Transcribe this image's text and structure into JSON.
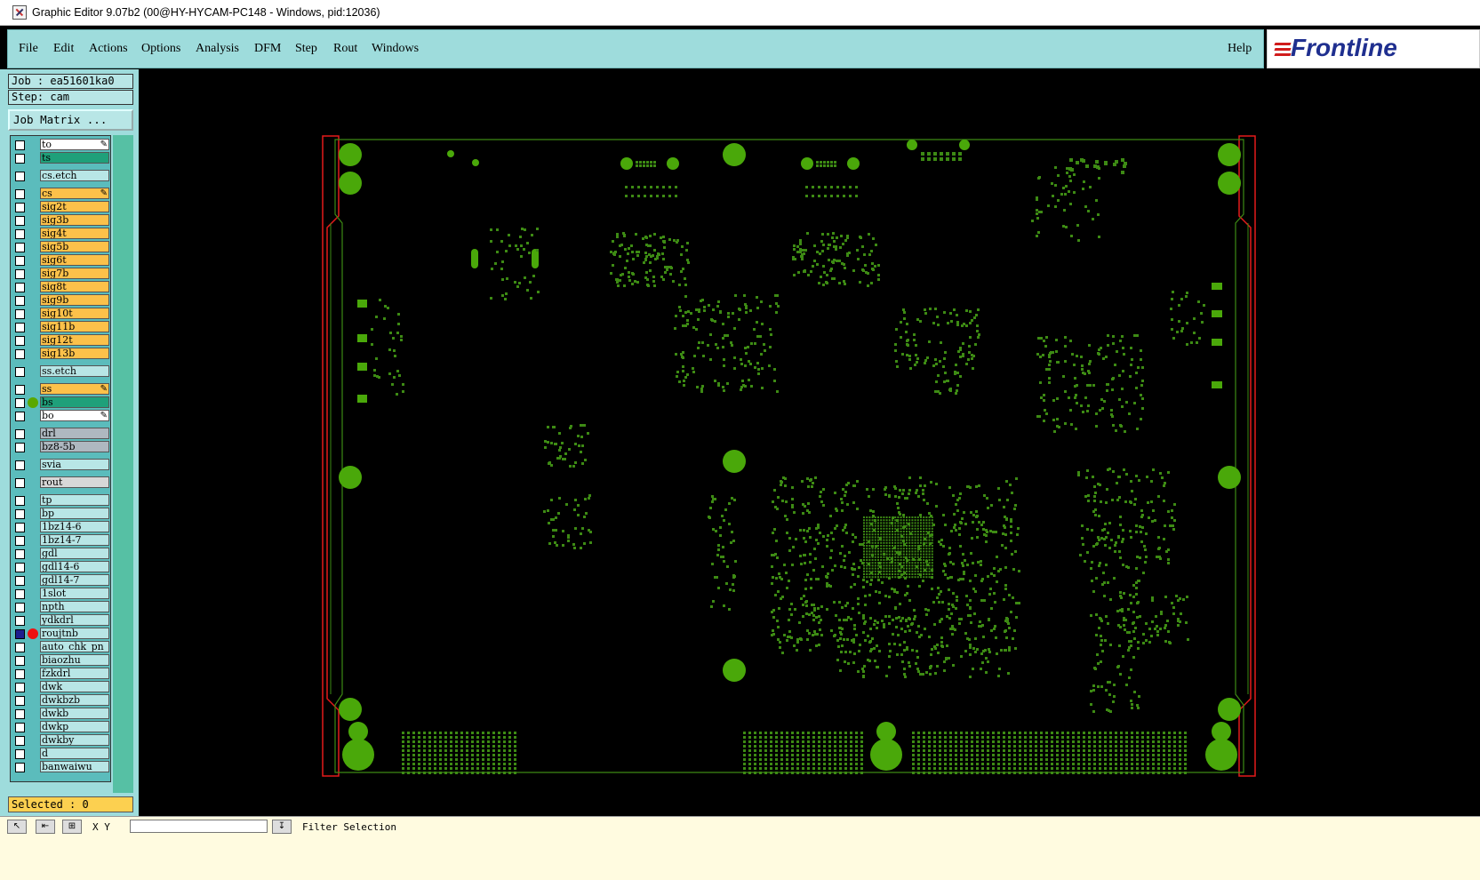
{
  "window": {
    "title": "Graphic Editor 9.07b2 (00@HY-HYCAM-PC148 - Windows, pid:12036)"
  },
  "menu": {
    "file": "File",
    "edit": "Edit",
    "actions": "Actions",
    "options": "Options",
    "analysis": "Analysis",
    "dfm": "DFM",
    "step": "Step",
    "rout": "Rout",
    "windows": "Windows",
    "help": "Help"
  },
  "brand": {
    "logo_text": "Frontline"
  },
  "job": {
    "job_line": "Job : ea51601ka0",
    "step_line": "Step: cam",
    "matrix_button": "Job Matrix ..."
  },
  "layers": [
    {
      "name": "to",
      "color": "#ffffff",
      "side": "top"
    },
    {
      "name": "ts",
      "color": "#1fa07a"
    },
    {
      "name": "cs.etch",
      "color": "#b8e6e6"
    },
    {
      "name": "cs",
      "color": "#fcc14a",
      "side": "top"
    },
    {
      "name": "sig2t",
      "color": "#fcc14a"
    },
    {
      "name": "sig3b",
      "color": "#fcc14a"
    },
    {
      "name": "sig4t",
      "color": "#fcc14a"
    },
    {
      "name": "sig5b",
      "color": "#fcc14a"
    },
    {
      "name": "sig6t",
      "color": "#fcc14a"
    },
    {
      "name": "sig7b",
      "color": "#fcc14a"
    },
    {
      "name": "sig8t",
      "color": "#fcc14a"
    },
    {
      "name": "sig9b",
      "color": "#fcc14a"
    },
    {
      "name": "sig10t",
      "color": "#fcc14a"
    },
    {
      "name": "sig11b",
      "color": "#fcc14a"
    },
    {
      "name": "sig12t",
      "color": "#fcc14a"
    },
    {
      "name": "sig13b",
      "color": "#fcc14a"
    },
    {
      "name": "ss.etch",
      "color": "#b8e6e6"
    },
    {
      "name": "ss",
      "color": "#fcc14a",
      "side": "bottom"
    },
    {
      "name": "bs",
      "color": "#1fa07a",
      "dot": "#5aa800"
    },
    {
      "name": "bo",
      "color": "#ffffff",
      "side": "bottom"
    },
    {
      "name": "drl",
      "color": "#aeb8c0"
    },
    {
      "name": "bz8-5b",
      "color": "#aeb8c0"
    },
    {
      "name": "svia",
      "color": "#b8e6e6"
    },
    {
      "name": "rout",
      "color": "#d8d8d8"
    },
    {
      "name": "tp",
      "color": "#b8e6e6"
    },
    {
      "name": "bp",
      "color": "#b8e6e6"
    },
    {
      "name": "1bz14-6",
      "color": "#b8e6e6"
    },
    {
      "name": "1bz14-7",
      "color": "#b8e6e6"
    },
    {
      "name": "gdl",
      "color": "#b8e6e6"
    },
    {
      "name": "gdl14-6",
      "color": "#b8e6e6"
    },
    {
      "name": "gdl14-7",
      "color": "#b8e6e6"
    },
    {
      "name": "1slot",
      "color": "#b8e6e6"
    },
    {
      "name": "npth",
      "color": "#b8e6e6"
    },
    {
      "name": "ydkdrl",
      "color": "#b8e6e6"
    },
    {
      "name": "roujtnb",
      "color": "#b8e6e6",
      "dot": "#ee1111",
      "checked": true
    },
    {
      "name": "auto_chk_pn",
      "color": "#b8e6e6"
    },
    {
      "name": "biaozhu",
      "color": "#b8e6e6"
    },
    {
      "name": "fzkdrl",
      "color": "#b8e6e6"
    },
    {
      "name": "dwk",
      "color": "#b8e6e6"
    },
    {
      "name": "dwkbzb",
      "color": "#b8e6e6"
    },
    {
      "name": "dwkb",
      "color": "#b8e6e6"
    },
    {
      "name": "dwkp",
      "color": "#b8e6e6"
    },
    {
      "name": "dwkby",
      "color": "#b8e6e6"
    },
    {
      "name": "d",
      "color": "#b8e6e6"
    },
    {
      "name": "banwaiwu",
      "color": "#b8e6e6"
    }
  ],
  "selection": {
    "label": "Selected : 0"
  },
  "status": {
    "coord_label": "X Y",
    "message": "Filter Selection"
  },
  "colors": {
    "pcb_green": "#3d8a14",
    "pad_green": "#4aa80a",
    "outline_red": "#e41a1a",
    "canvas_bg": "#000000"
  }
}
